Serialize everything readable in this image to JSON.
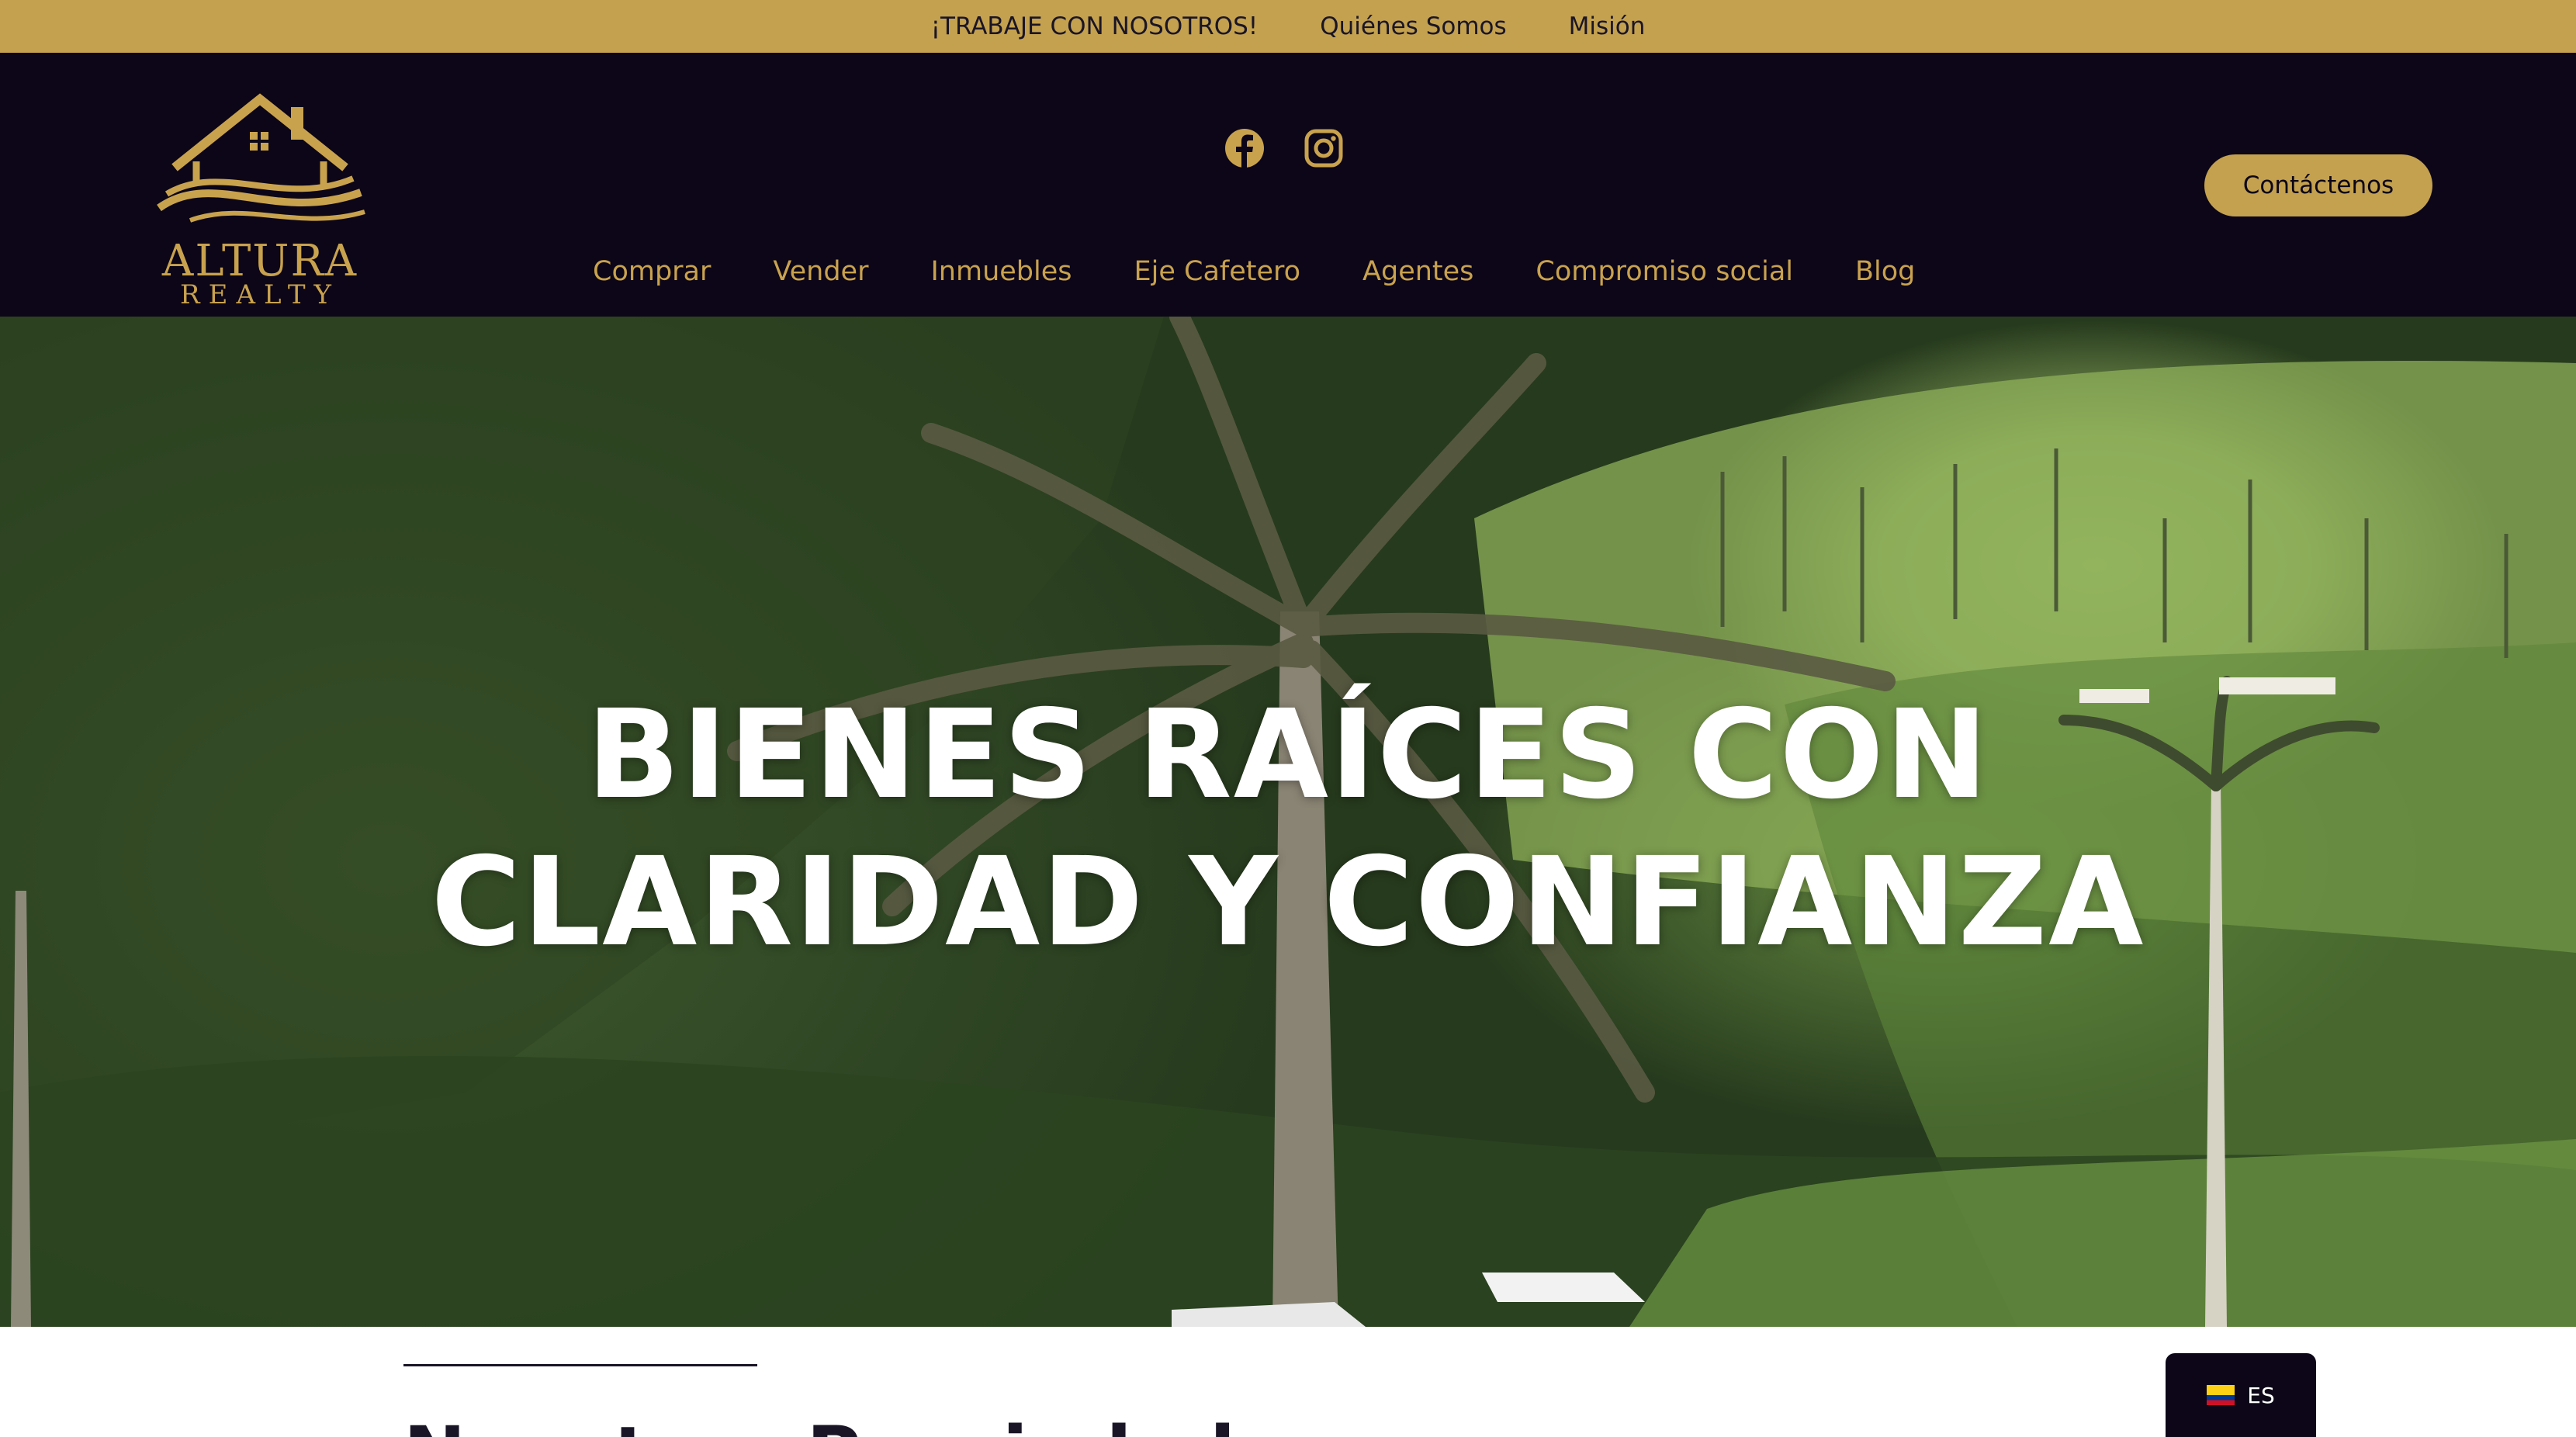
{
  "topbar": {
    "links": [
      "¡TRABAJE CON NOSOTROS!",
      "Quiénes Somos",
      "Misión"
    ],
    "color": "#c4a14e"
  },
  "header": {
    "logo": {
      "line1": "ALTURA",
      "line2": "REALTY"
    },
    "social": [
      "facebook-icon",
      "instagram-icon"
    ],
    "nav": [
      "Comprar",
      "Vender",
      "Inmuebles",
      "Eje Cafetero",
      "Agentes",
      "Compromiso social",
      "Blog"
    ],
    "cta": "Contáctenos",
    "background": "#0c0618",
    "accent": "#c9a24e"
  },
  "hero": {
    "title_line1": "BIENES RAÍCES CON",
    "title_line2": "CLARIDAD Y CONFIANZA"
  },
  "below": {
    "heading": "Nuestras Propiedades"
  },
  "language": {
    "code": "ES",
    "flag": "colombia-flag-icon"
  }
}
